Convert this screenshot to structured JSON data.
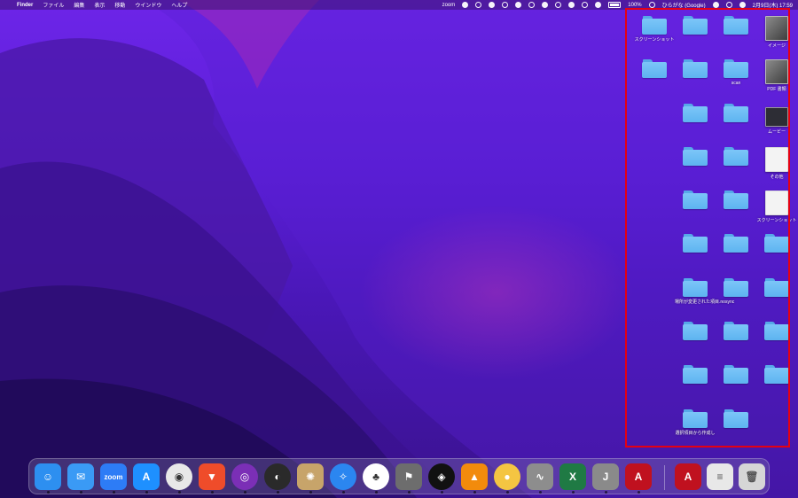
{
  "menubar": {
    "apple": "",
    "app_name": "Finder",
    "menus": [
      "ファイル",
      "編集",
      "表示",
      "移動",
      "ウインドウ",
      "ヘルプ"
    ],
    "zoom_label": "zoom",
    "battery_percent": "100%",
    "input_method": "ひらがな (Google)",
    "datetime": "2月9日(木) 17:59"
  },
  "desktop_icons": [
    {
      "label": "スクリーンショット",
      "kind": "folder"
    },
    {
      "label": "",
      "kind": "folder"
    },
    {
      "label": "",
      "kind": "folder"
    },
    {
      "label": "イメージ",
      "kind": "stack"
    },
    {
      "label": "",
      "kind": "folder"
    },
    {
      "label": "",
      "kind": "folder"
    },
    {
      "label": "scan",
      "kind": "folder"
    },
    {
      "label": "PDF 書類",
      "kind": "stack"
    },
    {
      "label": "",
      "kind": "folder"
    },
    {
      "label": "",
      "kind": "folder"
    },
    {
      "label": "ムービー",
      "kind": "movie"
    },
    {
      "label": "",
      "kind": "folder"
    },
    {
      "label": "",
      "kind": "folder"
    },
    {
      "label": "その他",
      "kind": "paper"
    },
    {
      "label": "",
      "kind": "folder"
    },
    {
      "label": "",
      "kind": "folder"
    },
    {
      "label": "スクリーンショット",
      "kind": "paper"
    },
    {
      "label": "",
      "kind": "folder"
    },
    {
      "label": "",
      "kind": "folder"
    },
    {
      "label": "",
      "kind": "folder"
    },
    {
      "label": "場所が変更された項目.nosync",
      "kind": "folder"
    },
    {
      "label": "",
      "kind": "folder"
    },
    {
      "label": "",
      "kind": "folder"
    },
    {
      "label": "",
      "kind": "folder"
    },
    {
      "label": "",
      "kind": "folder"
    },
    {
      "label": "",
      "kind": "folder"
    },
    {
      "label": "",
      "kind": "folder"
    },
    {
      "label": "",
      "kind": "folder"
    },
    {
      "label": "",
      "kind": "folder"
    },
    {
      "label": "選択項目から作成し",
      "kind": "folder"
    },
    {
      "label": "",
      "kind": "folder"
    }
  ],
  "dock": {
    "zoom_label": "zoom",
    "apps": [
      {
        "name": "finder",
        "glyph": "☺",
        "color": "#2d8ff0"
      },
      {
        "name": "mail",
        "glyph": "✉",
        "color": "#3a9af5"
      },
      {
        "name": "zoom",
        "glyph": "zoom",
        "color": "#2d7cf6"
      },
      {
        "name": "app-store",
        "glyph": "A",
        "color": "#1e90ff"
      },
      {
        "name": "chrome",
        "glyph": "◉",
        "color": "#e8e8e8"
      },
      {
        "name": "brave",
        "glyph": "▼",
        "color": "#ef4c2a"
      },
      {
        "name": "tor-browser",
        "glyph": "◎",
        "color": "#7b2fb6"
      },
      {
        "name": "obs",
        "glyph": "◐",
        "color": "#2a2a2a"
      },
      {
        "name": "cinematic",
        "glyph": "✺",
        "color": "#c7a46a"
      },
      {
        "name": "safari",
        "glyph": "✧",
        "color": "#2b86f0"
      },
      {
        "name": "evernote",
        "glyph": "♣",
        "color": "#ffffff"
      },
      {
        "name": "transmit",
        "glyph": "⚑",
        "color": "#6d6d6d"
      },
      {
        "name": "davinci",
        "glyph": "◈",
        "color": "#111111"
      },
      {
        "name": "vlc",
        "glyph": "▲",
        "color": "#f28b0c"
      },
      {
        "name": "messages",
        "glyph": "●",
        "color": "#f4c542"
      },
      {
        "name": "activity-monitor",
        "glyph": "∿",
        "color": "#8d8d8d"
      },
      {
        "name": "excel",
        "glyph": "X",
        "color": "#1f7a44"
      },
      {
        "name": "jstream",
        "glyph": "J",
        "color": "#8a8a8a"
      },
      {
        "name": "acrobat",
        "glyph": "A",
        "color": "#c0111f"
      }
    ],
    "docs": [
      {
        "name": "pdf-document",
        "glyph": "A",
        "color": "#c0111f"
      },
      {
        "name": "text-document",
        "glyph": "≡",
        "color": "#e8e8e8"
      },
      {
        "name": "trash",
        "glyph": "🗑",
        "color": "#d6d6d6"
      }
    ]
  }
}
